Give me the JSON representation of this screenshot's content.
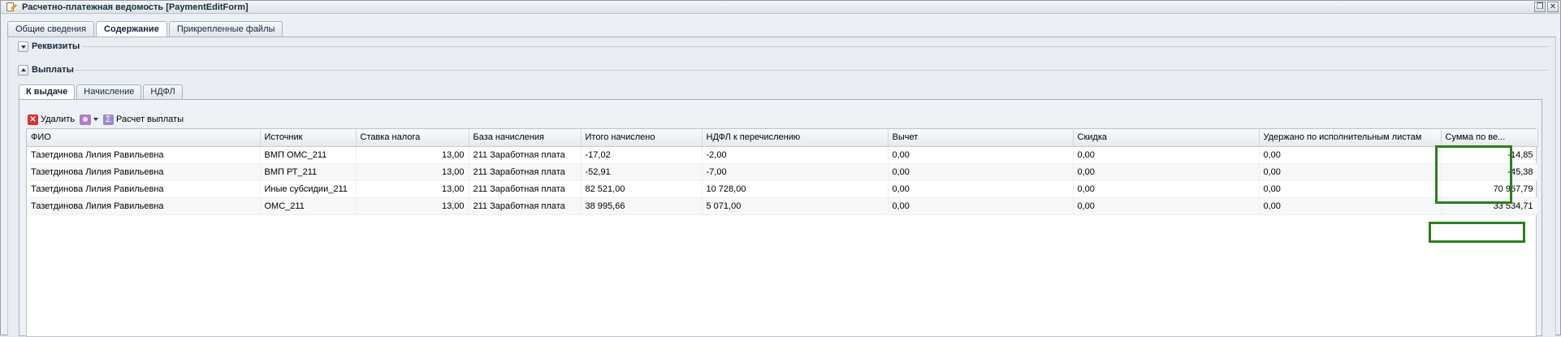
{
  "window": {
    "title": "Расчетно-платежная ведомость [PaymentEditForm]",
    "restore_glyph": "❐",
    "close_glyph": "✕"
  },
  "main_tabs": [
    {
      "label": "Общие сведения",
      "active": false
    },
    {
      "label": "Содержание",
      "active": true
    },
    {
      "label": "Прикрепленные файлы",
      "active": false
    }
  ],
  "sections": {
    "requisites": "Реквизиты",
    "payments": "Выплаты"
  },
  "inner_tabs": [
    {
      "label": "К выдаче",
      "active": true
    },
    {
      "label": "Начисление",
      "active": false
    },
    {
      "label": "НДФЛ",
      "active": false
    }
  ],
  "toolbar": {
    "delete_label": "Удалить",
    "calc_label": "Расчет выплаты"
  },
  "grid": {
    "columns": [
      "ФИО",
      "Источник",
      "Ставка налога",
      "База начисления",
      "Итого начислено",
      "НДФЛ к перечислению",
      "Вычет",
      "Скидка",
      "Удержано по исполнительным листам",
      "Сумма по ве..."
    ],
    "rows": [
      [
        "Тазетдинова Лилия Равильевна",
        "ВМП ОМС_211",
        "13,00",
        "211 Заработная плата",
        "-17,02",
        "-2,00",
        "0,00",
        "0,00",
        "0,00",
        "-14,85"
      ],
      [
        "Тазетдинова Лилия Равильевна",
        "ВМП РТ_211",
        "13,00",
        "211 Заработная плата",
        "-52,91",
        "-7,00",
        "0,00",
        "0,00",
        "0,00",
        "-45,38"
      ],
      [
        "Тазетдинова Лилия Равильевна",
        "Иные субсидии_211",
        "13,00",
        "211 Заработная плата",
        "82 521,00",
        "10 728,00",
        "0,00",
        "0,00",
        "0,00",
        "70 967,79"
      ],
      [
        "Тазетдинова Лилия Равильевна",
        "ОМС_211",
        "13,00",
        "211 Заработная плата",
        "38 995,66",
        "5 071,00",
        "0,00",
        "0,00",
        "0,00",
        "33 534,71"
      ]
    ]
  },
  "colors": {
    "highlight": "#2e7d1e"
  }
}
